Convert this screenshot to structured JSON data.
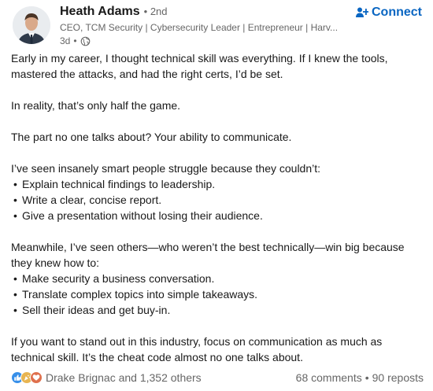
{
  "author": {
    "name": "Heath Adams",
    "degree": "• 2nd",
    "headline": "CEO, TCM Security | Cybersecurity Leader | Entrepreneur | Harv...",
    "time": "3d",
    "time_separator": "•",
    "avatar_icon": "profile-photo",
    "visibility_icon": "globe-icon"
  },
  "actions": {
    "connect_label": "Connect",
    "connect_icon": "person-add-icon",
    "accent_color": "#0a66c2"
  },
  "post": {
    "paragraphs": [
      {
        "lines": [
          "Early in my career, I thought technical skill was everything. If I knew the tools, mastered the attacks, and had the right certs, I’d be set."
        ]
      },
      {
        "lines": [
          "In reality, that’s only half the game."
        ]
      },
      {
        "lines": [
          "The part no one talks about? Your ability to communicate."
        ]
      },
      {
        "lines": [
          "I’ve seen insanely smart people struggle because they couldn’t:"
        ]
      },
      {
        "bullets": [
          "Explain technical findings to leadership.",
          "Write a clear, concise report.",
          "Give a presentation without losing their audience."
        ]
      },
      {
        "lines": [
          "Meanwhile, I’ve seen others—who weren’t the best technically—win big because they knew how to:"
        ]
      },
      {
        "bullets": [
          "Make security a business conversation.",
          "Translate complex topics into simple takeaways.",
          "Sell their ideas and get buy-in."
        ]
      },
      {
        "lines": [
          "If you want to stand out in this industry, focus on communication as much as technical skill. It’s the cheat code almost no one talks about."
        ]
      }
    ],
    "intro": "Early in my career, I thought technical skill was everything. If I knew the tools, mastered the attacks, and had the right certs, I’d be set.",
    "half_game": "In reality, that’s only half the game.",
    "no_one": "The part no one talks about? Your ability to communicate.",
    "struggle": "I’ve seen insanely smart people struggle because they couldn’t:",
    "bullets_a": [
      "Explain technical findings to leadership.",
      "Write a clear, concise report.",
      "Give a presentation without losing their audience."
    ],
    "meanwhile": "Meanwhile, I’ve seen others—who weren’t the best technically—win big because they knew how to:",
    "bullets_b": [
      "Make security a business conversation.",
      "Translate complex topics into simple takeaways.",
      "Sell their ideas and get buy-in."
    ],
    "closing": "If you want to stand out in this industry, focus on communication as much as technical skill. It’s the cheat code almost no one talks about.",
    "bullet_glyph": "•"
  },
  "social": {
    "reaction_icons": [
      "like-icon",
      "celebrate-icon",
      "love-icon"
    ],
    "reactors": "Drake Brignac and 1,352 others",
    "comments": "68 comments",
    "separator": "•",
    "reposts": "90 reposts"
  }
}
